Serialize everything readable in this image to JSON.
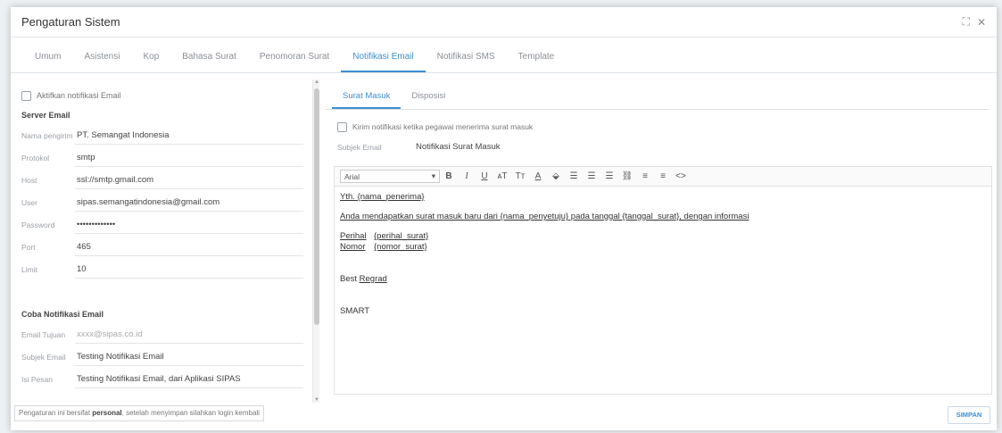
{
  "window": {
    "title": "Pengaturan Sistem",
    "resize_icon": "expand-icon",
    "close_label": "✕"
  },
  "tabs": [
    {
      "label": "Umum"
    },
    {
      "label": "Asistensi"
    },
    {
      "label": "Kop"
    },
    {
      "label": "Bahasa Surat"
    },
    {
      "label": "Penomoran Surat"
    },
    {
      "label": "Notifikasi Email",
      "active": true
    },
    {
      "label": "Notifikasi SMS"
    },
    {
      "label": "Template"
    }
  ],
  "left": {
    "enable_label": "Aktifkan notifikasi Email",
    "server_section": "Server Email",
    "fields": [
      {
        "label": "Nama pengirim",
        "value": "PT. Semangat Indonesia"
      },
      {
        "label": "Protokol",
        "value": "smtp"
      },
      {
        "label": "Host",
        "value": "ssl://smtp.gmail.com"
      },
      {
        "label": "User",
        "value": "sipas.semangatindonesia@gmail.com"
      },
      {
        "label": "Password",
        "value": "•••••••••••••"
      },
      {
        "label": "Port",
        "value": "465"
      },
      {
        "label": "Limit",
        "value": "10"
      }
    ],
    "test_section": "Coba Notifikasi Email",
    "test_fields": [
      {
        "label": "Email Tujuan",
        "placeholder": "xxxx@sipas.co.id"
      },
      {
        "label": "Subjek Email",
        "value": "Testing Notifikasi Email"
      },
      {
        "label": "Isi Pesan",
        "value": "Testing Notifikasi Email, dari Aplikasi SIPAS"
      }
    ]
  },
  "right": {
    "subtabs": [
      {
        "label": "Surat Masuk",
        "active": true
      },
      {
        "label": "Disposisi"
      }
    ],
    "notify_label": "Kirim notifikasi ketika pegawai menerima surat masuk",
    "subject_label": "Subjek Email",
    "subject_value": "Notifikasi Surat Masuk",
    "font": "Arial",
    "toolbar_glyphs": {
      "bold": "B",
      "italic": "I",
      "underline": "U",
      "font_size_up": "ᴀT",
      "font_size_down": "Tт",
      "font_color": "A",
      "highlight": "⬙",
      "align_left": "☰",
      "align_center": "☰",
      "align_right": "☰",
      "link": "⛓",
      "ordered_list": "≡",
      "bullet_list": "≡",
      "source": "<>"
    },
    "body": {
      "greeting": "Yth. {nama_penerima}",
      "intro": "Anda mendapatkan surat masuk baru dari {nama_penyetuju} pada tanggal {tanggal_surat}, dengan informasi",
      "perihal_key": "Perihal",
      "perihal_val": "{perihal_surat}",
      "nomor_key": "Nomor",
      "nomor_val": "{nomor_surat}",
      "regards_1": "Best",
      "regards_2": "Regrad",
      "signature": "SMART"
    }
  },
  "footer": {
    "note_prefix": "Pengaturan ini bersifat",
    "note_bold": "personal",
    "note_suffix": ", setelah menyimpan silahkan login kembali",
    "save_label": "SIMPAN"
  },
  "colors": {
    "accent": "#3a8fd6"
  }
}
